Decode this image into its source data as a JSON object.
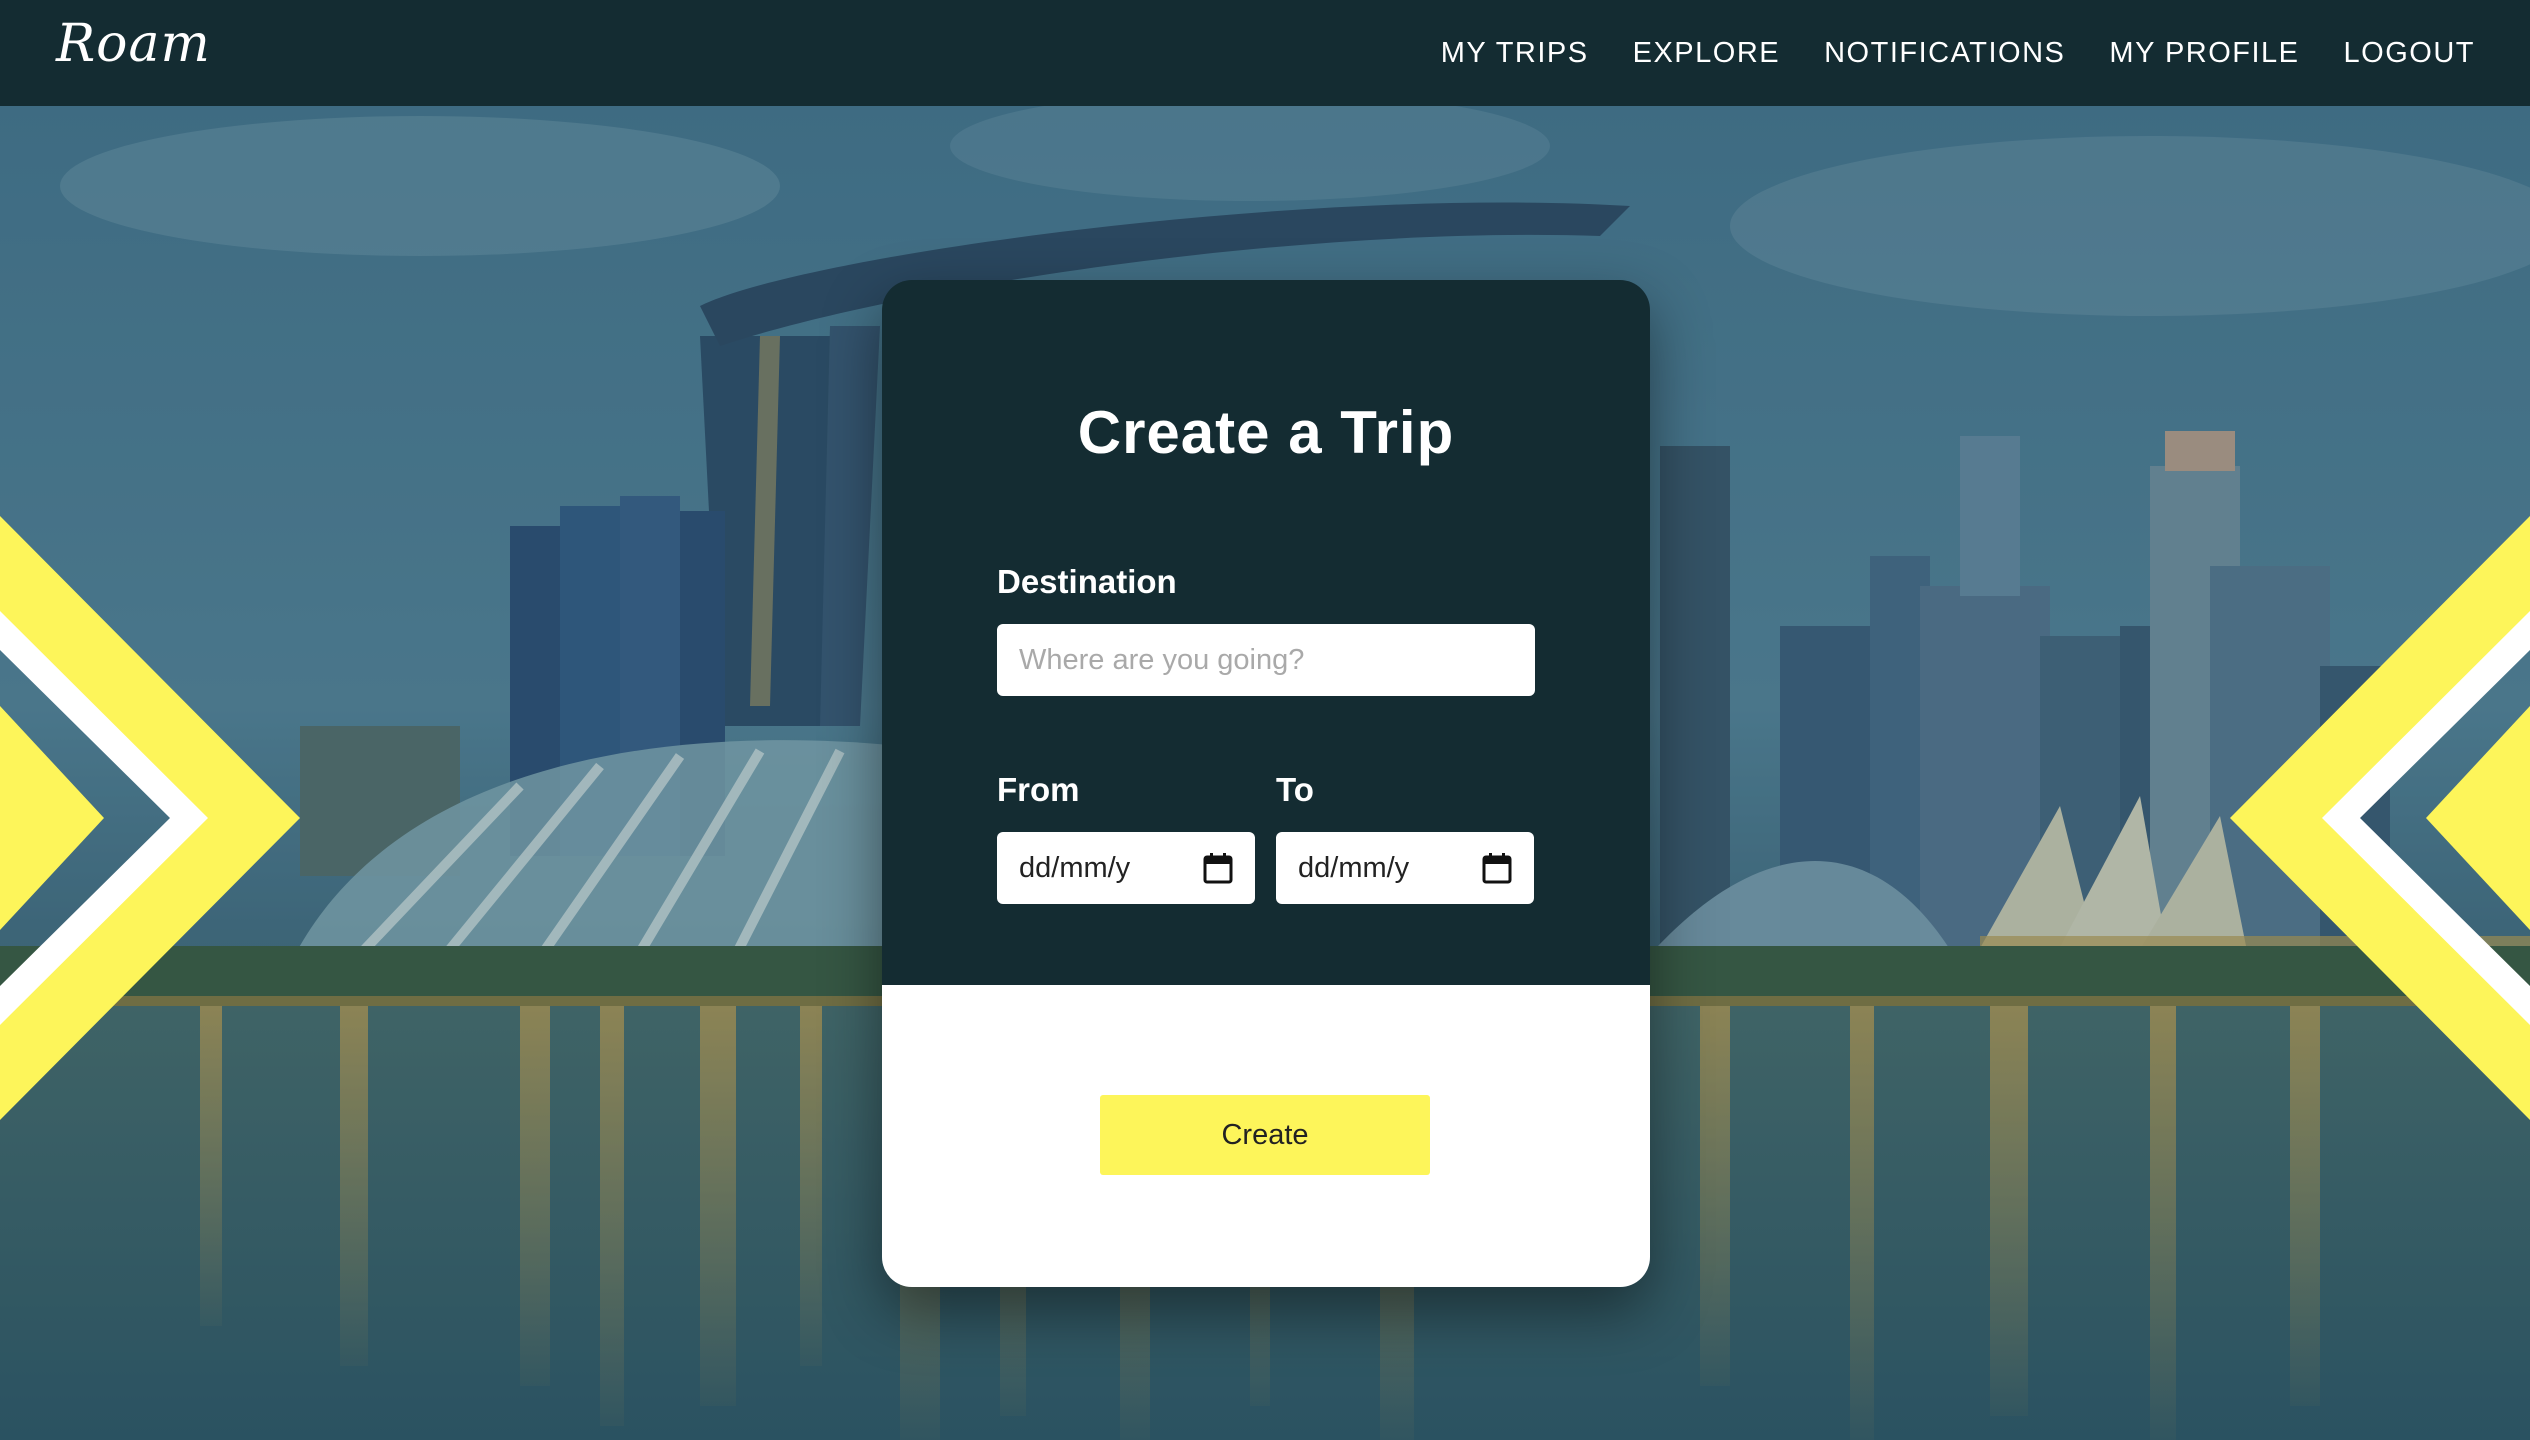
{
  "app": {
    "logo": "Roam"
  },
  "nav": {
    "items": [
      {
        "label": "MY TRIPS"
      },
      {
        "label": "EXPLORE"
      },
      {
        "label": "NOTIFICATIONS"
      },
      {
        "label": "MY PROFILE"
      },
      {
        "label": "LOGOUT"
      }
    ]
  },
  "form": {
    "title": "Create a Trip",
    "destination": {
      "label": "Destination",
      "placeholder": "Where are you going?",
      "value": ""
    },
    "from": {
      "label": "From",
      "value": "dd/mm/y"
    },
    "to": {
      "label": "To",
      "value": "dd/mm/y"
    },
    "submit_label": "Create"
  },
  "icons": {
    "date_picker": "calendar-icon",
    "decoration": "chevron-arrow-icon"
  },
  "colors": {
    "navbar": "#142c32",
    "card_dark": "#142c32",
    "accent_yellow": "#fdf55a",
    "white": "#ffffff"
  }
}
